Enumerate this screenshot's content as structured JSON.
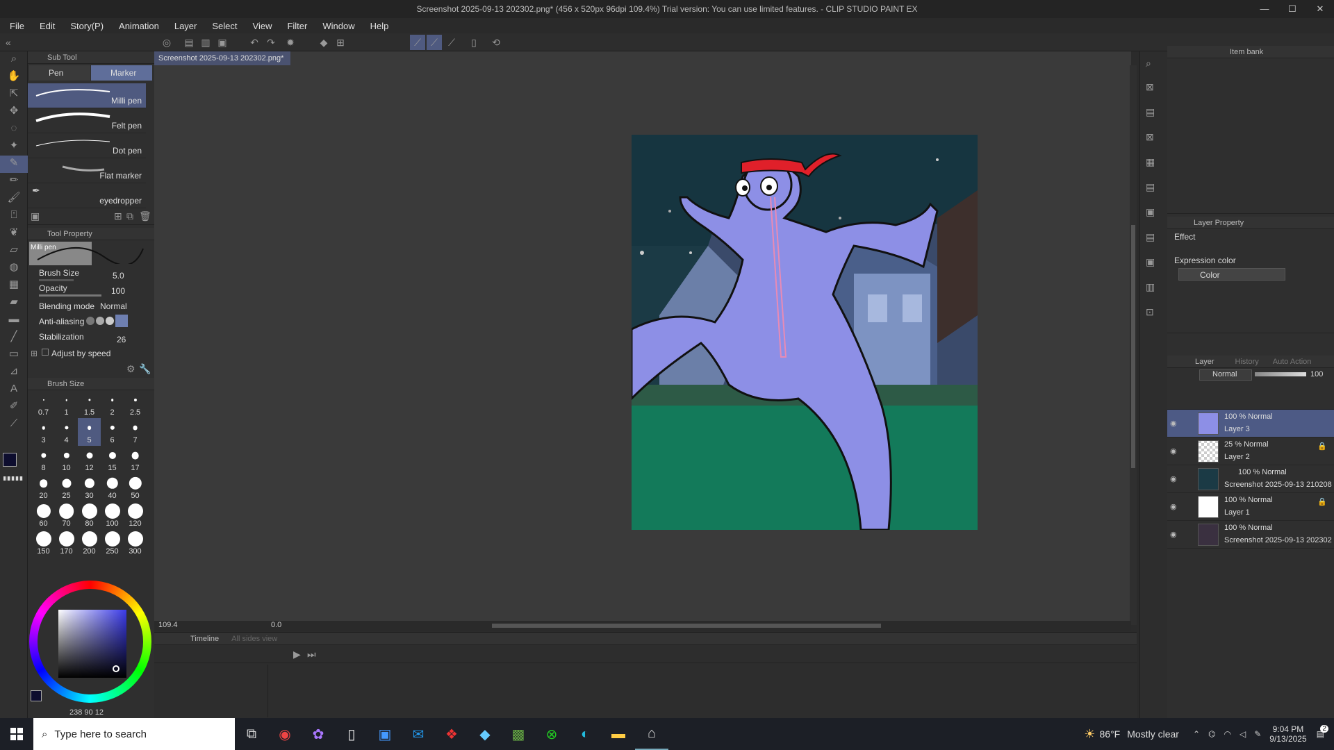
{
  "window": {
    "title": "Screenshot 2025-09-13 202302.png* (456 x 520px 96dpi 109.4%)  Trial version: You can use limited features. - CLIP STUDIO PAINT EX",
    "min": "—",
    "max": "☐",
    "close": "✕"
  },
  "menu": [
    "File",
    "Edit",
    "Story(P)",
    "Animation",
    "Layer",
    "Select",
    "View",
    "Filter",
    "Window",
    "Help"
  ],
  "subtool": {
    "header": "Sub Tool",
    "tabs": [
      "Pen",
      "Marker"
    ],
    "brushes": [
      "Milli pen",
      "Felt pen",
      "Dot pen",
      "Flat marker",
      "eyedropper"
    ]
  },
  "toolprop": {
    "header": "Tool Property",
    "preview_label": "Milli pen",
    "brush_size_label": "Brush Size",
    "brush_size": "5.0",
    "opacity_label": "Opacity",
    "opacity": "100",
    "blend_label": "Blending mode",
    "blend": "Normal",
    "aa_label": "Anti-aliasing",
    "stab_label": "Stabilization",
    "stab": "26",
    "adjust_label": "Adjust by speed"
  },
  "brushsize": {
    "header": "Brush Size",
    "sizes": [
      "0.7",
      "1",
      "1.5",
      "2",
      "2.5",
      "3",
      "4",
      "5",
      "6",
      "7",
      "8",
      "10",
      "12",
      "15",
      "17",
      "20",
      "25",
      "30",
      "40",
      "50",
      "60",
      "70",
      "80",
      "100",
      "120",
      "150",
      "170",
      "200",
      "250",
      "300"
    ],
    "selected": "5"
  },
  "color": {
    "readout": [
      "238",
      "90",
      "12"
    ],
    "main": "#0d0d2e",
    "sub": "#ffffff"
  },
  "document": {
    "tab": "Screenshot 2025-09-13 202302.png*"
  },
  "status": {
    "zoom": "109.4",
    "angle": "0.0"
  },
  "timeline": {
    "header": "Timeline",
    "sub": "All sides view"
  },
  "itembank": {
    "header": "Item bank"
  },
  "layerprop": {
    "header": "Layer Property",
    "effect": "Effect",
    "expr_label": "Expression color",
    "expr": "Color"
  },
  "layers": {
    "tabs": [
      "Layer",
      "History",
      "Auto Action"
    ],
    "blend": "Normal",
    "opacity": "100",
    "items": [
      {
        "pct": "100 % Normal",
        "name": "Layer 3"
      },
      {
        "pct": "25 % Normal",
        "name": "Layer 2"
      },
      {
        "pct": "100 % Normal",
        "name": "Screenshot 2025-09-13 210208"
      },
      {
        "pct": "100 % Normal",
        "name": "Layer 1"
      },
      {
        "pct": "100 % Normal",
        "name": "Screenshot 2025-09-13 202302"
      }
    ]
  },
  "taskbar": {
    "search": "Type here to search",
    "temp": "86°F",
    "weather": "Mostly clear",
    "time": "9:04 PM",
    "date": "9/13/2025",
    "notif": "2"
  }
}
